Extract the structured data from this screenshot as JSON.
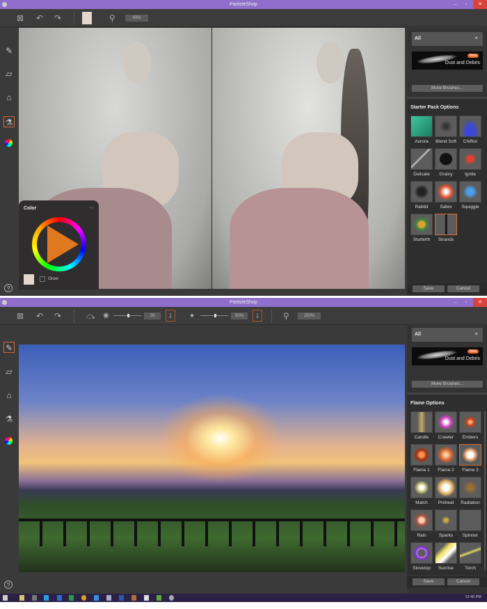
{
  "windows": [
    {
      "title": "ParticleShop",
      "toolbar": {
        "zoom": "49%"
      },
      "color_panel": {
        "title": "Color",
        "glow_label": "Glow"
      },
      "panel": {
        "category": "All",
        "featured_brush": "Dust and Debris",
        "new_badge": "New",
        "more_brushes": "More Brushes...",
        "section_title": "Starter Pack Options",
        "brushes": [
          "Aurora",
          "Blend Soft",
          "Chiffon",
          "Delicate",
          "Grainy",
          "Ignite",
          "Rabbit",
          "Sabre",
          "Squiggle",
          "Starbirth",
          "Strands"
        ],
        "selected": "Strands",
        "save": "Save",
        "cancel": "Cancel"
      }
    },
    {
      "title": "ParticleShop",
      "toolbar": {
        "size": "28",
        "opacity": "50%",
        "zoom": "250%"
      },
      "panel": {
        "category": "All",
        "featured_brush": "Dust and Debris",
        "new_badge": "New",
        "more_brushes": "More Brushes...",
        "section_title": "Flame Options",
        "brushes": [
          "Candle",
          "Crawler",
          "Embers",
          "Flame 1",
          "Flame 2",
          "Flame 3",
          "Match",
          "Preheat",
          "Radiation",
          "Rain",
          "Sparks",
          "Spinner",
          "Stovetop",
          "Sunrise",
          "Torch"
        ],
        "selected": "Flame 3",
        "save": "Save",
        "cancel": "Cancel"
      }
    }
  ],
  "taskbar": {
    "time": "12:40 PM"
  },
  "colors": {
    "titlebar": "#8f6fcb",
    "close": "#d9433c",
    "accent": "#d06a3a"
  }
}
